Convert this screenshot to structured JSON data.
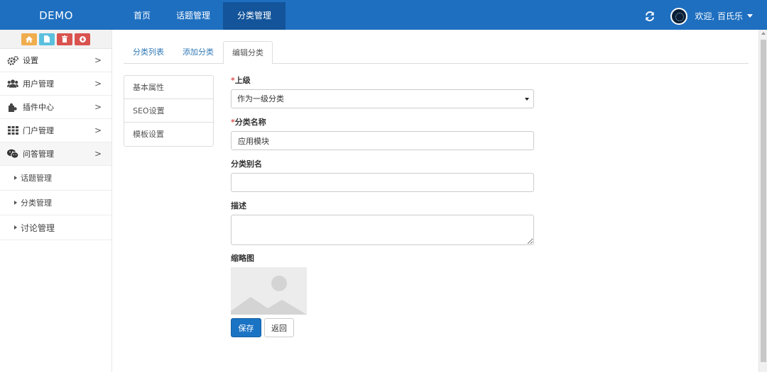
{
  "header": {
    "brand": "DEMO",
    "nav": [
      {
        "label": "首页"
      },
      {
        "label": "话题管理"
      },
      {
        "label": "分类管理"
      }
    ],
    "welcome": "欢迎, 百氏乐"
  },
  "sidebar": {
    "items": [
      {
        "label": "设置",
        "icon": "gears-icon"
      },
      {
        "label": "用户管理",
        "icon": "users-icon"
      },
      {
        "label": "插件中心",
        "icon": "puzzle-icon"
      },
      {
        "label": "门户管理",
        "icon": "grid-icon"
      },
      {
        "label": "问答管理",
        "icon": "wechat-icon"
      }
    ],
    "sub_items": [
      {
        "label": "话题管理"
      },
      {
        "label": "分类管理"
      },
      {
        "label": "讨论管理"
      }
    ],
    "chevron": ">"
  },
  "tabs": [
    {
      "label": "分类列表"
    },
    {
      "label": "添加分类"
    },
    {
      "label": "编辑分类"
    }
  ],
  "subnav": [
    {
      "label": "基本属性"
    },
    {
      "label": "SEO设置"
    },
    {
      "label": "模板设置"
    }
  ],
  "form": {
    "parent": {
      "required_mark": "*",
      "label": "上级",
      "value": "作为一级分类"
    },
    "name": {
      "required_mark": "*",
      "label": "分类名称",
      "value": "应用模块"
    },
    "alias": {
      "label": "分类别名",
      "value": ""
    },
    "description": {
      "label": "描述",
      "value": ""
    },
    "thumbnail": {
      "label": "缩略图"
    }
  },
  "buttons": {
    "save": "保存",
    "back": "返回"
  },
  "colors": {
    "header_bg": "#1e6fc0",
    "header_active": "#13549a",
    "primary": "#1b73c4",
    "required": "#d9534f"
  }
}
